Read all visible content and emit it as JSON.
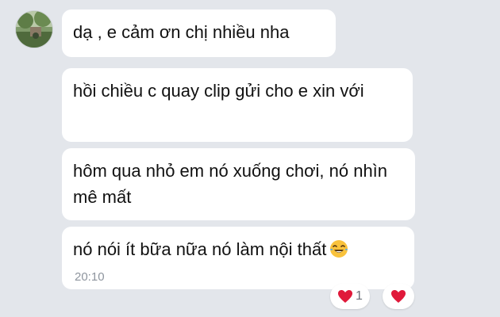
{
  "messages": [
    {
      "text": "dạ , e cảm ơn chị nhiều nha"
    },
    {
      "text": "hồi chiều c quay clip gửi cho e xin với"
    },
    {
      "text": "hôm qua nhỏ em nó xuống chơi, nó nhìn mê mất"
    },
    {
      "text": "nó nói ít bữa nữa nó làm nội thất",
      "emoji": "laughing-tears-emoji",
      "time": "20:10"
    }
  ],
  "reactions": {
    "heart_icon": "heart-icon",
    "count": "1",
    "color": "#e0193a"
  },
  "colors": {
    "background": "#e3e6eb",
    "bubble": "#ffffff",
    "text": "#111111",
    "timestamp": "#8e959e"
  }
}
